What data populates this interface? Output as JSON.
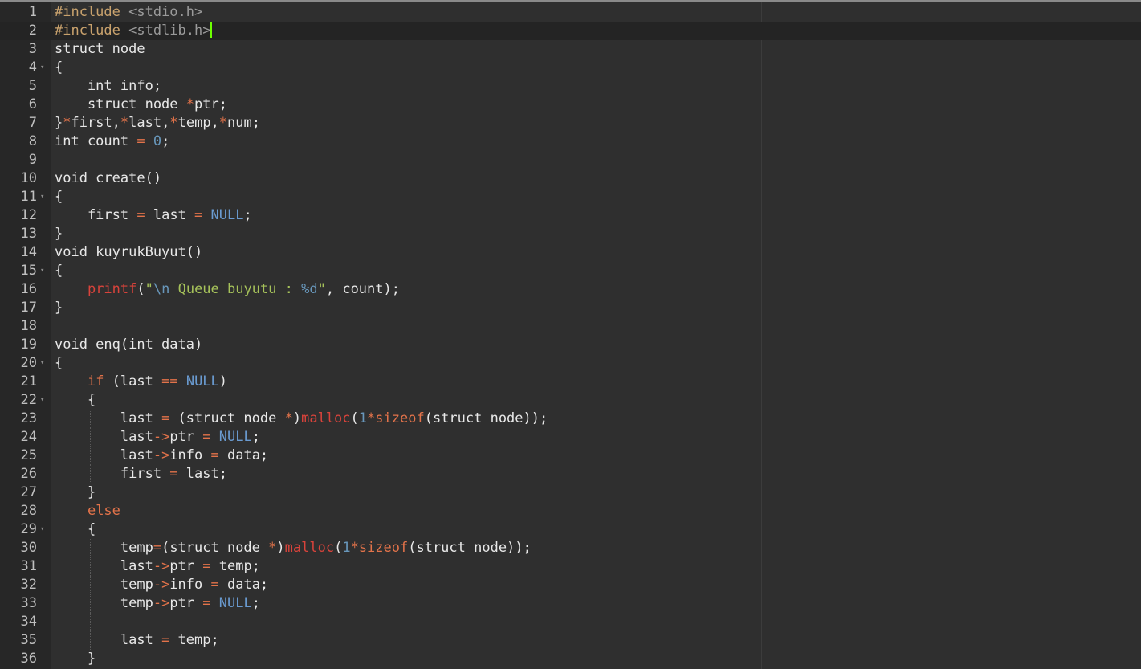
{
  "editor": {
    "active_line": 2,
    "lines": [
      {
        "n": "1",
        "tokens": [
          [
            "pre",
            "#include "
          ],
          [
            "inc",
            "<stdio.h>"
          ]
        ]
      },
      {
        "n": "2",
        "cursor": true,
        "tokens": [
          [
            "pre",
            "#include "
          ],
          [
            "inc",
            "<stdlib.h>"
          ]
        ]
      },
      {
        "n": "3",
        "tokens": [
          [
            "plain",
            "struct node"
          ]
        ]
      },
      {
        "n": "4",
        "fold": true,
        "tokens": [
          [
            "plain",
            "{"
          ]
        ]
      },
      {
        "n": "5",
        "tokens": [
          [
            "plain",
            "    int info;"
          ]
        ]
      },
      {
        "n": "6",
        "tokens": [
          [
            "plain",
            "    struct node "
          ],
          [
            "op",
            "*"
          ],
          [
            "plain",
            "ptr;"
          ]
        ]
      },
      {
        "n": "7",
        "tokens": [
          [
            "plain",
            "}"
          ],
          [
            "op",
            "*"
          ],
          [
            "plain",
            "first,"
          ],
          [
            "op",
            "*"
          ],
          [
            "plain",
            "last,"
          ],
          [
            "op",
            "*"
          ],
          [
            "plain",
            "temp,"
          ],
          [
            "op",
            "*"
          ],
          [
            "plain",
            "num;"
          ]
        ]
      },
      {
        "n": "8",
        "tokens": [
          [
            "plain",
            "int count "
          ],
          [
            "op",
            "="
          ],
          [
            "plain",
            " "
          ],
          [
            "num",
            "0"
          ],
          [
            "plain",
            ";"
          ]
        ]
      },
      {
        "n": "9",
        "tokens": []
      },
      {
        "n": "10",
        "tokens": [
          [
            "plain",
            "void create()"
          ]
        ]
      },
      {
        "n": "11",
        "fold": true,
        "tokens": [
          [
            "plain",
            "{"
          ]
        ]
      },
      {
        "n": "12",
        "tokens": [
          [
            "plain",
            "    first "
          ],
          [
            "op",
            "="
          ],
          [
            "plain",
            " last "
          ],
          [
            "op",
            "="
          ],
          [
            "plain",
            " "
          ],
          [
            "const",
            "NULL"
          ],
          [
            "plain",
            ";"
          ]
        ]
      },
      {
        "n": "13",
        "tokens": [
          [
            "plain",
            "}"
          ]
        ]
      },
      {
        "n": "14",
        "tokens": [
          [
            "plain",
            "void kuyrukBuyut()"
          ]
        ]
      },
      {
        "n": "15",
        "fold": true,
        "tokens": [
          [
            "plain",
            "{"
          ]
        ]
      },
      {
        "n": "16",
        "tokens": [
          [
            "plain",
            "    "
          ],
          [
            "func",
            "printf"
          ],
          [
            "plain",
            "("
          ],
          [
            "str",
            "\""
          ],
          [
            "esc",
            "\\n"
          ],
          [
            "str",
            " Queue buyutu : "
          ],
          [
            "esc",
            "%d"
          ],
          [
            "str",
            "\""
          ],
          [
            "plain",
            ", count);"
          ]
        ]
      },
      {
        "n": "17",
        "tokens": [
          [
            "plain",
            "}"
          ]
        ]
      },
      {
        "n": "18",
        "tokens": []
      },
      {
        "n": "19",
        "tokens": [
          [
            "plain",
            "void enq(int data)"
          ]
        ]
      },
      {
        "n": "20",
        "fold": true,
        "tokens": [
          [
            "plain",
            "{"
          ]
        ]
      },
      {
        "n": "21",
        "tokens": [
          [
            "plain",
            "    "
          ],
          [
            "kw",
            "if"
          ],
          [
            "plain",
            " (last "
          ],
          [
            "op",
            "=="
          ],
          [
            "plain",
            " "
          ],
          [
            "const",
            "NULL"
          ],
          [
            "plain",
            ")"
          ]
        ]
      },
      {
        "n": "22",
        "fold": true,
        "tokens": [
          [
            "plain",
            "    {"
          ]
        ]
      },
      {
        "n": "23",
        "guide": true,
        "tokens": [
          [
            "plain",
            "        last "
          ],
          [
            "op",
            "="
          ],
          [
            "plain",
            " (struct node "
          ],
          [
            "op",
            "*"
          ],
          [
            "plain",
            ")"
          ],
          [
            "func",
            "malloc"
          ],
          [
            "plain",
            "("
          ],
          [
            "num",
            "1"
          ],
          [
            "op",
            "*"
          ],
          [
            "kw",
            "sizeof"
          ],
          [
            "plain",
            "(struct node));"
          ]
        ]
      },
      {
        "n": "24",
        "guide": true,
        "tokens": [
          [
            "plain",
            "        last"
          ],
          [
            "op",
            "->"
          ],
          [
            "plain",
            "ptr "
          ],
          [
            "op",
            "="
          ],
          [
            "plain",
            " "
          ],
          [
            "const",
            "NULL"
          ],
          [
            "plain",
            ";"
          ]
        ]
      },
      {
        "n": "25",
        "guide": true,
        "tokens": [
          [
            "plain",
            "        last"
          ],
          [
            "op",
            "->"
          ],
          [
            "plain",
            "info "
          ],
          [
            "op",
            "="
          ],
          [
            "plain",
            " data;"
          ]
        ]
      },
      {
        "n": "26",
        "guide": true,
        "tokens": [
          [
            "plain",
            "        first "
          ],
          [
            "op",
            "="
          ],
          [
            "plain",
            " last;"
          ]
        ]
      },
      {
        "n": "27",
        "tokens": [
          [
            "plain",
            "    }"
          ]
        ]
      },
      {
        "n": "28",
        "tokens": [
          [
            "plain",
            "    "
          ],
          [
            "kw",
            "else"
          ]
        ]
      },
      {
        "n": "29",
        "fold": true,
        "tokens": [
          [
            "plain",
            "    {"
          ]
        ]
      },
      {
        "n": "30",
        "guide": true,
        "tokens": [
          [
            "plain",
            "        temp"
          ],
          [
            "op",
            "="
          ],
          [
            "plain",
            "(struct node "
          ],
          [
            "op",
            "*"
          ],
          [
            "plain",
            ")"
          ],
          [
            "func",
            "malloc"
          ],
          [
            "plain",
            "("
          ],
          [
            "num",
            "1"
          ],
          [
            "op",
            "*"
          ],
          [
            "kw",
            "sizeof"
          ],
          [
            "plain",
            "(struct node));"
          ]
        ]
      },
      {
        "n": "31",
        "guide": true,
        "tokens": [
          [
            "plain",
            "        last"
          ],
          [
            "op",
            "->"
          ],
          [
            "plain",
            "ptr "
          ],
          [
            "op",
            "="
          ],
          [
            "plain",
            " temp;"
          ]
        ]
      },
      {
        "n": "32",
        "guide": true,
        "tokens": [
          [
            "plain",
            "        temp"
          ],
          [
            "op",
            "->"
          ],
          [
            "plain",
            "info "
          ],
          [
            "op",
            "="
          ],
          [
            "plain",
            " data;"
          ]
        ]
      },
      {
        "n": "33",
        "guide": true,
        "tokens": [
          [
            "plain",
            "        temp"
          ],
          [
            "op",
            "->"
          ],
          [
            "plain",
            "ptr "
          ],
          [
            "op",
            "="
          ],
          [
            "plain",
            " "
          ],
          [
            "const",
            "NULL"
          ],
          [
            "plain",
            ";"
          ]
        ]
      },
      {
        "n": "34",
        "guide": true,
        "tokens": []
      },
      {
        "n": "35",
        "guide": true,
        "tokens": [
          [
            "plain",
            "        last "
          ],
          [
            "op",
            "="
          ],
          [
            "plain",
            " temp;"
          ]
        ]
      },
      {
        "n": "36",
        "tokens": [
          [
            "plain",
            "    }"
          ]
        ]
      }
    ]
  },
  "colors": {
    "background": "#2f2f2f",
    "gutter": "#272727",
    "cursor": "#6dff00"
  }
}
